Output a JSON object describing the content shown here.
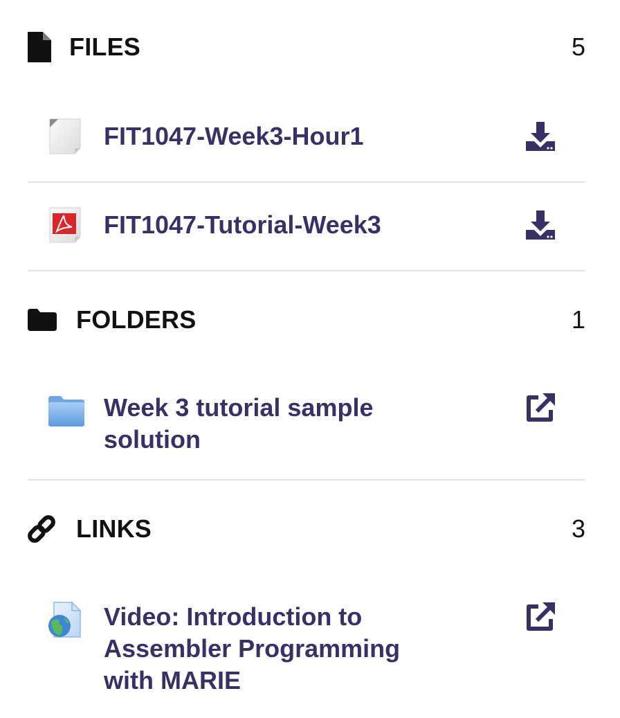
{
  "files": {
    "title": "FILES",
    "count": "5",
    "items": [
      {
        "label": "FIT1047-Week3-Hour1",
        "icon": "document-icon",
        "action": "download-icon"
      },
      {
        "label": "FIT1047-Tutorial-Week3",
        "icon": "pdf-icon",
        "action": "download-icon"
      }
    ]
  },
  "folders": {
    "title": "FOLDERS",
    "count": "1",
    "items": [
      {
        "label": "Week 3 tutorial sample solution",
        "icon": "folder-icon",
        "action": "external-link-icon"
      }
    ]
  },
  "links": {
    "title": "LINKS",
    "count": "3",
    "items": [
      {
        "label": "Video: Introduction to Assembler Programming with MARIE",
        "icon": "web-link-icon",
        "action": "external-link-icon"
      }
    ]
  },
  "colors": {
    "link_text": "#3a3068",
    "action_icon": "#3a3068",
    "header_text": "#111111",
    "divider": "#dee2e6"
  }
}
